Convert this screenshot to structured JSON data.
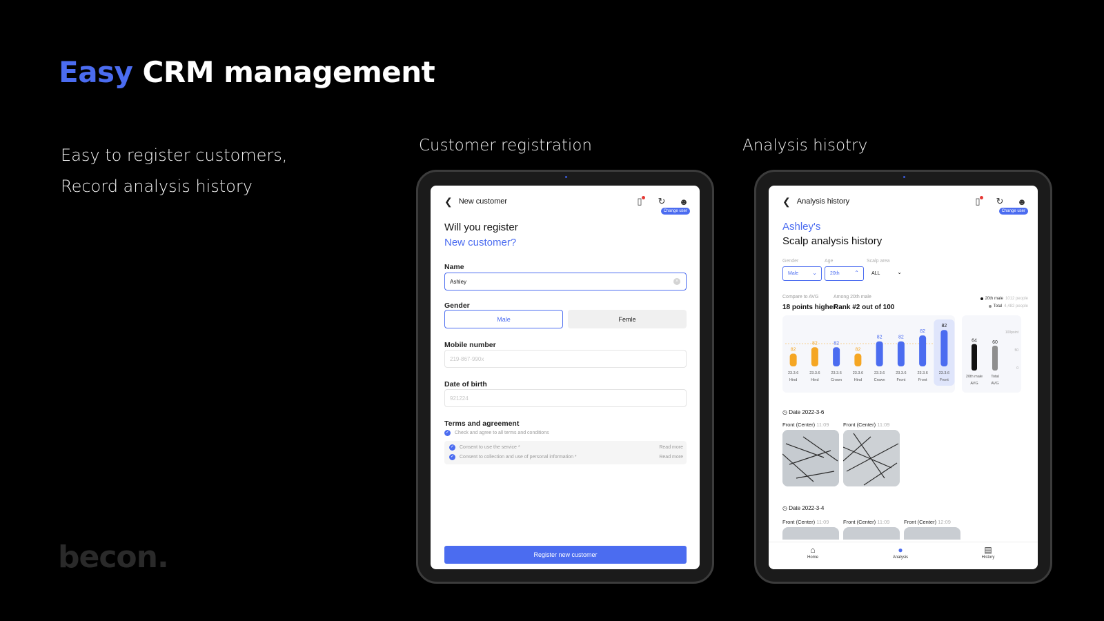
{
  "slide": {
    "headline_accent": "Easy",
    "headline_rest": " CRM management",
    "subtext_line1": "Easy to register customers,",
    "subtext_line2": "Record analysis history",
    "logo": "becon."
  },
  "sections": {
    "registration_title": "Customer registration",
    "history_title": "Analysis hisotry"
  },
  "registration": {
    "topbar_title": "New customer",
    "change_tip": "Change user",
    "question_line1": "Will you register",
    "question_line2": "New customer?",
    "name_label": "Name",
    "name_value": "Ashley",
    "gender_label": "Gender",
    "gender_male": "Male",
    "gender_female": "Femle",
    "mobile_label": "Mobile number",
    "mobile_placeholder": "219-867-990x",
    "dob_label": "Date of birth",
    "dob_placeholder": "921224",
    "terms_label": "Terms and agreement",
    "agree_all": "Check and agree to all terms and conditions",
    "consent_service": "Consent to use the service *",
    "consent_personal": "Consent to collection and use of personal information *",
    "read_more": "Read more",
    "register_button": "Register new customer"
  },
  "history": {
    "topbar_title": "Analysis history",
    "change_tip": "Change user",
    "customer_name": "Ashley's",
    "subtitle": "Scalp analysis history",
    "filters": {
      "gender_label": "Gender",
      "gender_value": "Male",
      "age_label": "Age",
      "age_value": "20th",
      "area_label": "Scalp area",
      "area_value": "ALL"
    },
    "compare_label": "Compare to AVG",
    "compare_value": "18 points higher",
    "rank_label": "Among 20th male",
    "rank_value": "Rank #2 out of 100",
    "legend_male": "20th male",
    "legend_male_n": "1012 people",
    "legend_total": "Total",
    "legend_total_n": "4,482 people",
    "date1": "Date  2022-3-6",
    "date2": "Date  2022-3-4",
    "thumbs1": [
      {
        "label": "Front (Center)",
        "time": "11:09"
      },
      {
        "label": "Front (Center)",
        "time": "11:09"
      }
    ],
    "thumbs2": [
      {
        "label": "Front (Center)",
        "time": "11:09"
      },
      {
        "label": "Front (Center)",
        "time": "11:09"
      },
      {
        "label": "Front (Center)",
        "time": "12:09"
      }
    ],
    "nav": {
      "home": "Home",
      "analysis": "Analysis",
      "history": "History"
    }
  },
  "chart_data": [
    {
      "type": "bar",
      "title": "",
      "categories": [
        "23.3.6 Hind",
        "23.3.6 Hind",
        "23.3.6 Crown",
        "23.3.6 Hind",
        "23.3.6 Crown",
        "23.3.6 Front",
        "23.3.6 Front",
        "23.3.6 Front"
      ],
      "values": [
        82,
        82,
        82,
        82,
        82,
        82,
        82,
        82
      ],
      "colors": [
        "#f5a623",
        "#f5a623",
        "#4b6cf0",
        "#f5a623",
        "#4b6cf0",
        "#4b6cf0",
        "#4b6cf0",
        "#4b6cf0"
      ],
      "bar_heights": [
        0.28,
        0.42,
        0.42,
        0.28,
        0.55,
        0.55,
        0.68,
        0.8
      ],
      "highlighted_index": 7,
      "ylim": [
        0,
        100
      ]
    },
    {
      "type": "bar",
      "title": "",
      "categories": [
        "20th male AVG",
        "Total AVG"
      ],
      "values": [
        64,
        60
      ],
      "colors": [
        "#111111",
        "#8e8e8e"
      ],
      "ytick_labels": [
        "100point",
        "50",
        "0"
      ],
      "ylim": [
        0,
        100
      ]
    }
  ]
}
